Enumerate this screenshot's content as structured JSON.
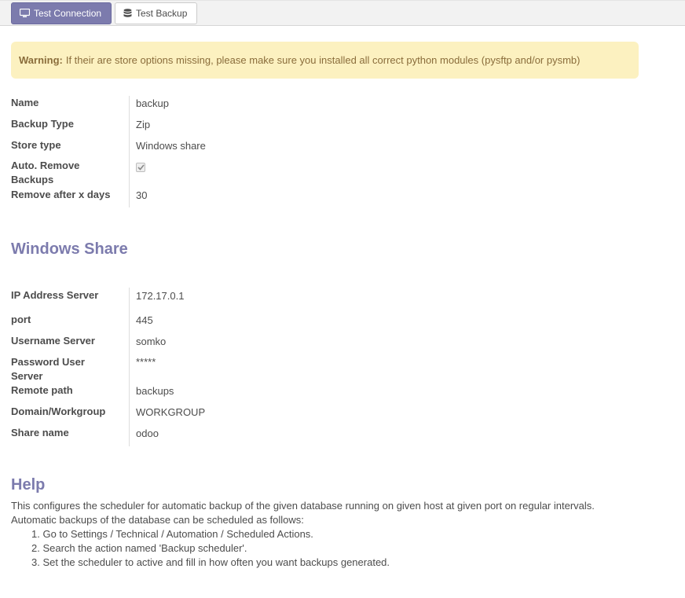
{
  "toolbar": {
    "test_connection": "Test Connection",
    "test_backup": "Test Backup"
  },
  "alert": {
    "strong": "Warning:",
    "text": "If their are store options missing, please make sure you installed all correct python modules (pysftp and/or pysmb)"
  },
  "general": {
    "name_label": "Name",
    "name_value": "backup",
    "backup_type_label": "Backup Type",
    "backup_type_value": "Zip",
    "store_type_label": "Store type",
    "store_type_value": "Windows share",
    "auto_remove_label_1": "Auto. Remove",
    "auto_remove_label_2": "Backups",
    "auto_remove_checked": true,
    "remove_days_label": "Remove after x days",
    "remove_days_value": "30"
  },
  "share": {
    "title": "Windows Share",
    "ip_label": "IP Address Server",
    "ip_value": "172.17.0.1",
    "port_label": "port",
    "port_value": "445",
    "username_label": "Username Server",
    "username_value": "somko",
    "password_label_1": "Password User",
    "password_label_2": "Server",
    "password_value": "*****",
    "remote_path_label": "Remote path",
    "remote_path_value": "backups",
    "domain_label": "Domain/Workgroup",
    "domain_value": "WORKGROUP",
    "share_name_label": "Share name",
    "share_name_value": "odoo"
  },
  "help": {
    "title": "Help",
    "line1": "This configures the scheduler for automatic backup of the given database running on given host at given port on regular intervals.",
    "line2": "Automatic backups of the database can be scheduled as follows:",
    "steps": [
      "1. Go to Settings / Technical / Automation / Scheduled Actions.",
      "2. Search the action named 'Backup scheduler'.",
      "3. Set the scheduler to active and fill in how often you want backups generated."
    ]
  },
  "colors": {
    "primary": "#7c7bad",
    "warning_bg": "#fcf1c0",
    "warning_text": "#8a6d3b"
  }
}
